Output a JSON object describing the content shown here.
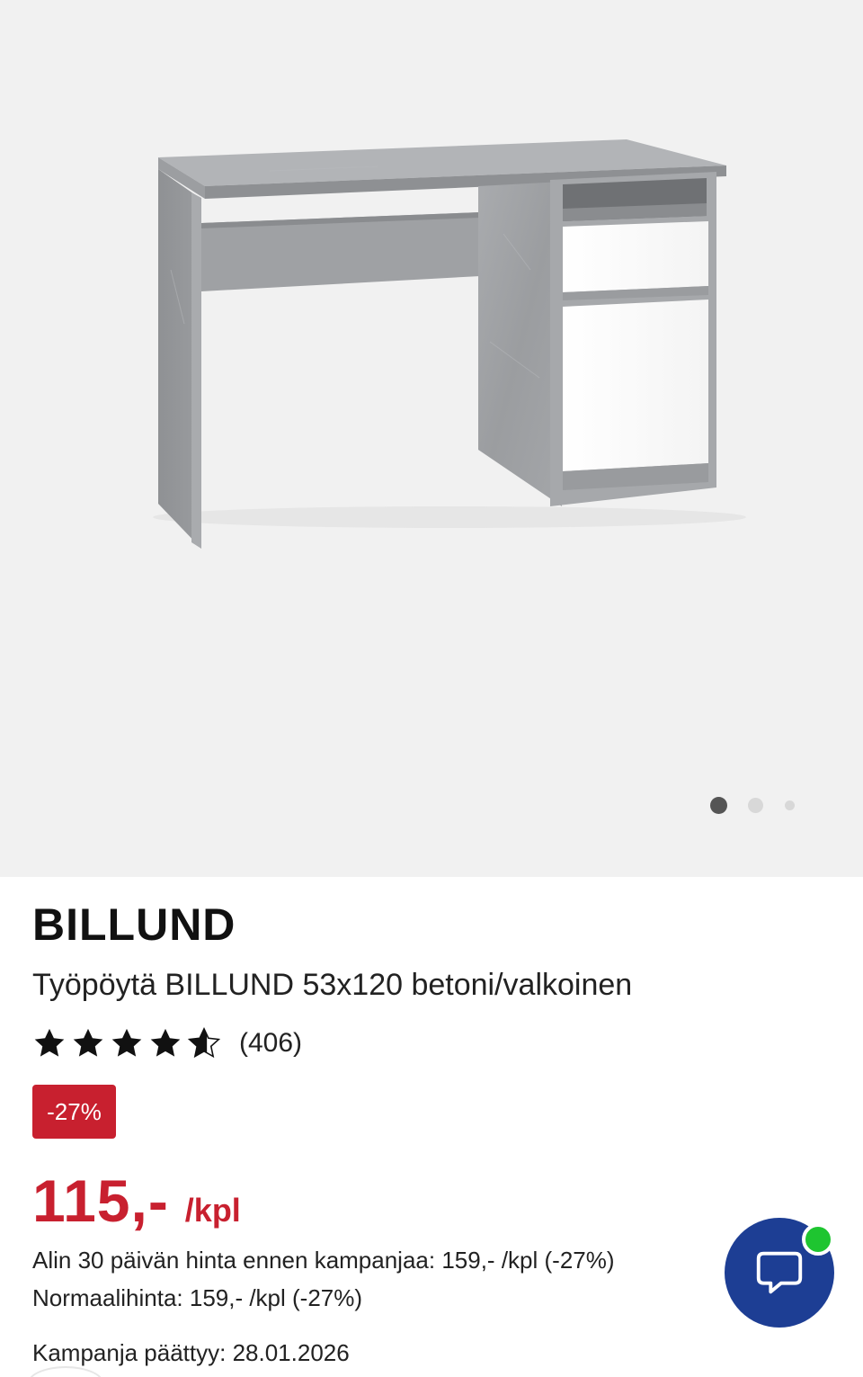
{
  "gallery": {
    "image_alt": "Työpöytä BILLUND 53x120 betoni/valkoinen",
    "image_count": 3,
    "active_index": 0
  },
  "product": {
    "brand": "BILLUND",
    "name": "Työpöytä BILLUND 53x120 betoni/valkoinen",
    "rating": 4.5,
    "rating_max": 5,
    "review_count": "(406)",
    "discount_badge": "-27%",
    "price_amount": "115,-",
    "price_unit": "/kpl",
    "lowest_price_note": "Alin 30 päivän hinta ennen kampanjaa: 159,- /kpl (-27%)",
    "normal_price_note": "Normaalihinta: 159,- /kpl (-27%)",
    "campaign_end": "Kampanja päättyy: 28.01.2026"
  },
  "chat": {
    "icon": "chat-bubble-icon",
    "status": "online"
  },
  "colors": {
    "sale_red": "#c8202f",
    "chat_blue": "#1d3e94",
    "online_green": "#1ec530",
    "gallery_bg": "#f1f1f1"
  }
}
